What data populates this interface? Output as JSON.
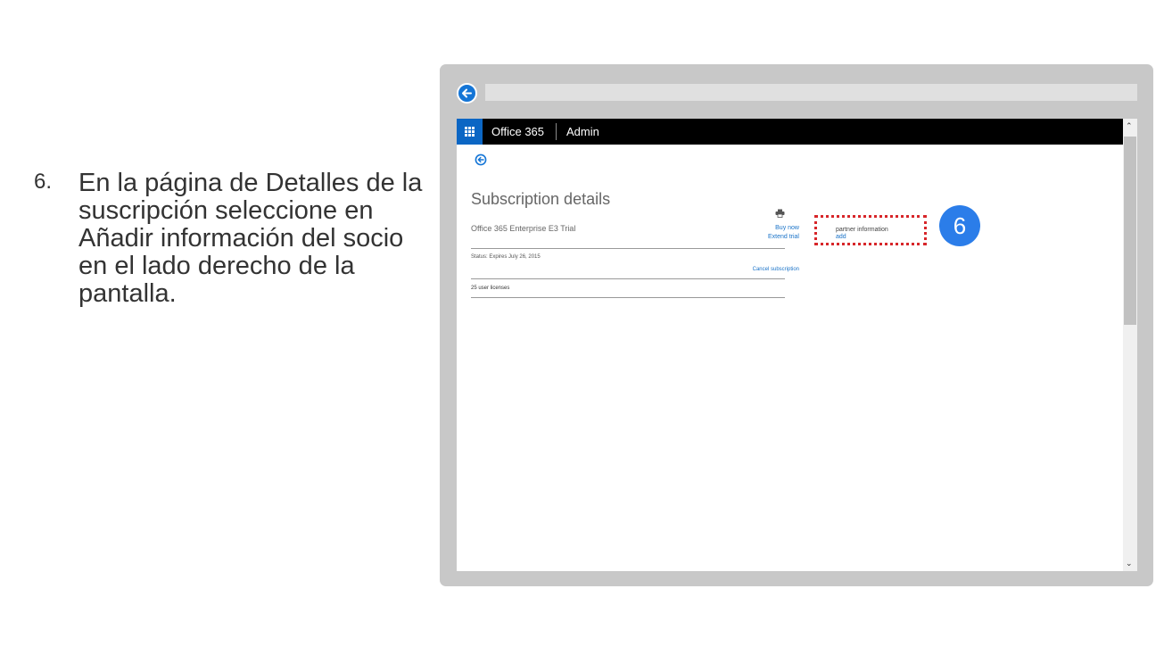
{
  "instruction": {
    "number": "6.",
    "text": "En la página de Detalles de la suscripción seleccione en Añadir información del socio en el lado derecho de la pantalla."
  },
  "admin_bar": {
    "brand": "Office 365",
    "section": "Admin"
  },
  "subscription": {
    "title": "Subscription details",
    "product": "Office 365 Enterprise E3 Trial",
    "buy_now": "Buy now",
    "extend_trial": "Extend trial",
    "status": "Status: Expires July 26, 2015",
    "cancel": "Cancel subscription",
    "licenses": "25 user licenses"
  },
  "partner": {
    "label": "partner information",
    "add_link": "add"
  },
  "step_badge": "6",
  "scrollbar": {
    "up_glyph": "⌃",
    "down_glyph": "⌄"
  },
  "colors": {
    "accent": "#1475d6",
    "highlight": "#d7262a",
    "badge": "#2b7de9"
  }
}
